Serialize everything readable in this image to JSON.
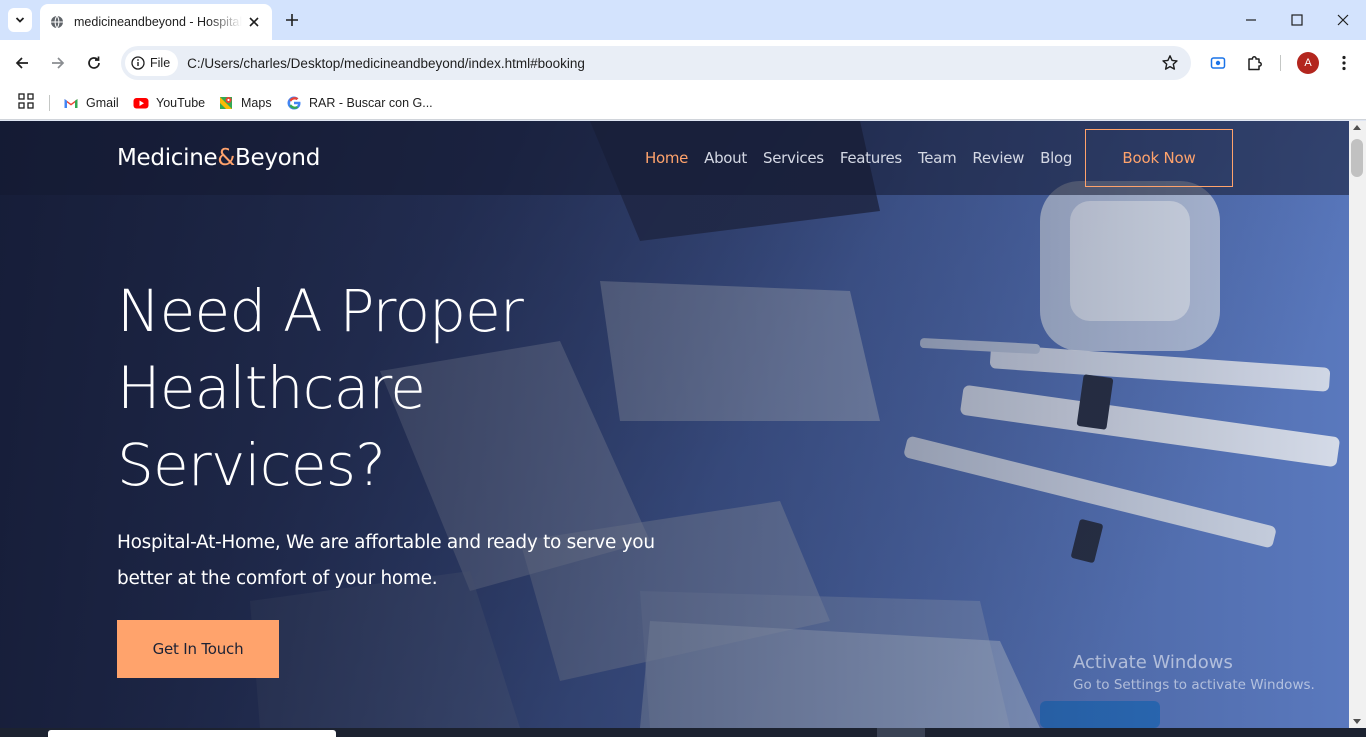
{
  "browser": {
    "tab_title": "medicineandbeyond - Hospital",
    "site_chip": "File",
    "url": "C:/Users/charles/Desktop/medicineandbeyond/index.html#booking",
    "profile_initial": "A",
    "bookmarks": [
      {
        "label": "Gmail",
        "icon": "gmail-icon"
      },
      {
        "label": "YouTube",
        "icon": "youtube-icon"
      },
      {
        "label": "Maps",
        "icon": "maps-icon"
      },
      {
        "label": "RAR - Buscar con G...",
        "icon": "google-icon"
      }
    ]
  },
  "site": {
    "logo_part1": "Medicine",
    "logo_amp": "&",
    "logo_part2": "Beyond",
    "nav": [
      "Home",
      "About",
      "Services",
      "Features",
      "Team",
      "Review",
      "Blog"
    ],
    "active_nav": "Home",
    "book_now": "Book Now",
    "hero_title": "Need A Proper Healthcare Services?",
    "hero_subtitle": "Hospital-At-Home, We are affortable and ready to serve you better at the comfort of your home.",
    "cta": "Get In Touch"
  },
  "watermark": {
    "line1": "Activate Windows",
    "line2": "Go to Settings to activate Windows."
  },
  "colors": {
    "accent": "#ffa36c",
    "tabstrip": "#d3e3fd",
    "hero_overlay": "#1e2746"
  }
}
